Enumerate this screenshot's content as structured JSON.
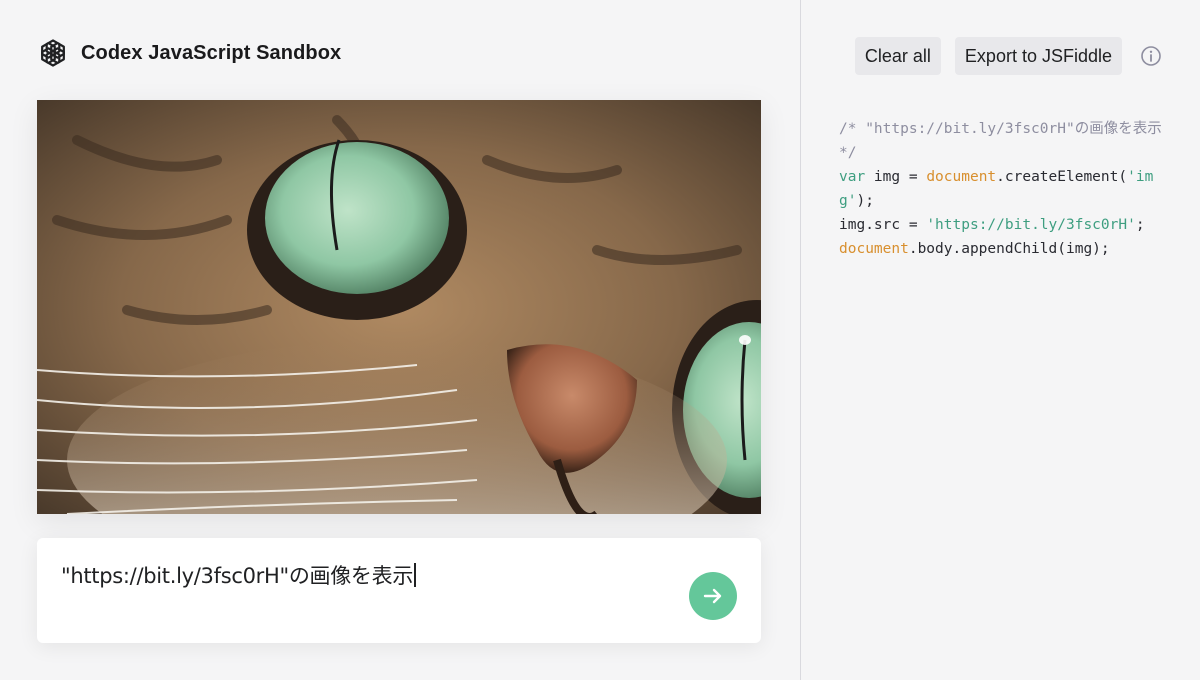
{
  "app": {
    "title": "Codex JavaScript Sandbox",
    "logo_icon": "openai-logo-icon"
  },
  "output": {
    "image_subject": "cat-face-closeup-icon"
  },
  "prompt": {
    "value": "\"https://bit.ly/3fsc0rH\"の画像を表示",
    "submit_icon": "arrow-right-icon"
  },
  "toolbar": {
    "clear_label": "Clear all",
    "export_label": "Export to JSFiddle",
    "info_icon": "info-icon"
  },
  "code": {
    "comment": "/* \"https://bit.ly/3fsc0rH\"の画像を表示 */",
    "line2_keyword": "var",
    "line2_var": " img = ",
    "line2_obj": "document",
    "line2_call": ".createElement(",
    "line2_arg": "'img'",
    "line2_end": ");",
    "line3_start": "img.src = ",
    "line3_str": "'https://bit.ly/3fsc0rH'",
    "line3_end": ";",
    "line4_obj": "document",
    "line4_rest": ".body.appendChild(img);"
  },
  "colors": {
    "accent_green": "#4fc08d",
    "code_keyword": "#3e9e80",
    "code_global": "#d88f2e",
    "code_comment": "#8e8ea0"
  }
}
